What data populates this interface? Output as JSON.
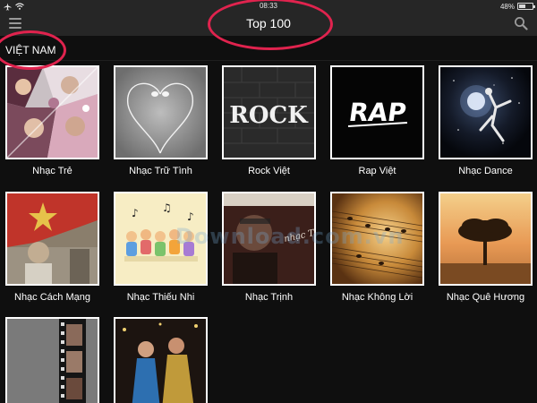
{
  "status_bar": {
    "time": "08:33",
    "battery": "48%",
    "battery_level": 0.48
  },
  "nav": {
    "title": "Top 100"
  },
  "section": {
    "title": "VIỆT NAM"
  },
  "items": [
    {
      "label": "Nhạc Trẻ"
    },
    {
      "label": "Nhạc Trữ Tình"
    },
    {
      "label": "Rock Việt",
      "art_text": "ROCK"
    },
    {
      "label": "Rap Việt",
      "art_text": "RAP"
    },
    {
      "label": "Nhạc Dance"
    },
    {
      "label": "Nhạc Cách Mạng"
    },
    {
      "label": "Nhạc Thiếu Nhi"
    },
    {
      "label": "Nhạc Trịnh",
      "art_text": "nhạc Trịnh"
    },
    {
      "label": "Nhạc Không Lời"
    },
    {
      "label": "Nhạc Quê Hương"
    },
    {
      "label": ""
    },
    {
      "label": ""
    }
  ],
  "watermark": "Download.com.vn",
  "colors": {
    "annotation": "#e0234e",
    "background": "#0f0f0f",
    "bar": "#262626"
  }
}
